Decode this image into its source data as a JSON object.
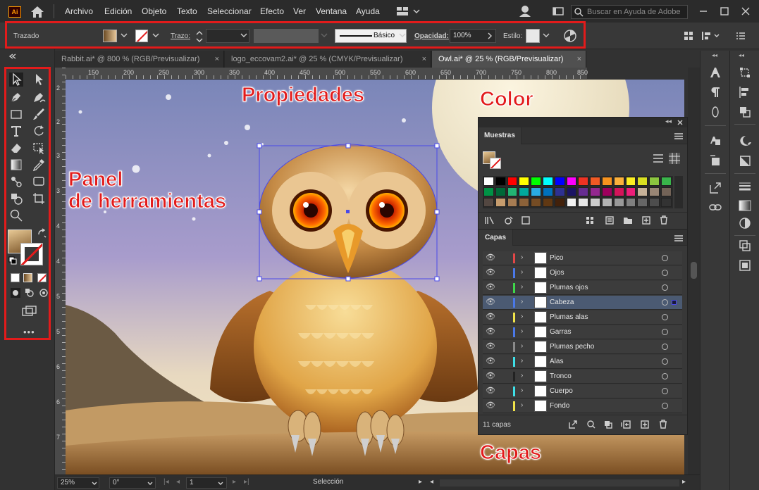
{
  "app": {
    "logo_text": "Ai",
    "menus": [
      "Archivo",
      "Edición",
      "Objeto",
      "Texto",
      "Seleccionar",
      "Efecto",
      "Ver",
      "Ventana",
      "Ayuda"
    ],
    "help_placeholder": "Buscar en Ayuda de Adobe"
  },
  "control_bar": {
    "mode_label": "Trazado",
    "stroke_label": "Trazo:",
    "brush_label": "Básico",
    "opacity_label": "Opacidad:",
    "opacity_value": "100%",
    "style_label": "Estilo:"
  },
  "tabs": [
    {
      "label": "Rabbit.ai* @ 800 % (RGB/Previsualizar)",
      "active": false
    },
    {
      "label": "logo_eccovam2.ai* @ 25 % (CMYK/Previsualizar)",
      "active": false
    },
    {
      "label": "Owl.ai* @ 25 % (RGB/Previsualizar)",
      "active": true
    }
  ],
  "tab_close_glyph": "×",
  "ruler": {
    "h": [
      "150",
      "200",
      "250",
      "300",
      "350",
      "400",
      "450",
      "500",
      "550",
      "600",
      "650",
      "700",
      "750",
      "800",
      "850"
    ],
    "v": [
      "2",
      "2",
      "3",
      "3",
      "4",
      "4",
      "5",
      "5",
      "6",
      "6",
      "7"
    ]
  },
  "annotations": {
    "properties": "Propiedades",
    "color": "Color",
    "tools_line1": "Panel",
    "tools_line2": "de herramientas",
    "layers": "Capas"
  },
  "swatches_panel": {
    "title": "Muestras",
    "colors": [
      "#ffffff",
      "#000000",
      "#ff0000",
      "#ffff00",
      "#00ff00",
      "#00ffff",
      "#0000ff",
      "#ff00ff",
      "#ee3223",
      "#f15a24",
      "#f7931e",
      "#fbb03b",
      "#fcee21",
      "#d9e021",
      "#8cc63f",
      "#39b54a",
      "#009245",
      "#006837",
      "#22b573",
      "#00a99d",
      "#29abe2",
      "#0071bc",
      "#2e3192",
      "#1b1464",
      "#662d91",
      "#93278f",
      "#9e005d",
      "#d4145a",
      "#ed1e79",
      "#c7b299",
      "#998675",
      "#736357",
      "#534741",
      "#c69c6d",
      "#a67c52",
      "#8c6239",
      "#754c24",
      "#603813",
      "#42210b",
      "#f2f2f2",
      "#e6e6e6",
      "#cccccc",
      "#b3b3b3",
      "#999999",
      "#808080",
      "#666666",
      "#4d4d4d",
      "#333333"
    ]
  },
  "layers_panel": {
    "title": "Capas",
    "count_text": "11 capas",
    "items": [
      {
        "name": "Pico",
        "color": "#e24747",
        "selected": false
      },
      {
        "name": "Ojos",
        "color": "#4a78e8",
        "selected": false
      },
      {
        "name": "Plumas ojos",
        "color": "#3ed64a",
        "selected": false
      },
      {
        "name": "Cabeza",
        "color": "#4a78e8",
        "selected": true
      },
      {
        "name": "Plumas alas",
        "color": "#f0e34a",
        "selected": false
      },
      {
        "name": "Garras",
        "color": "#4a78e8",
        "selected": false
      },
      {
        "name": "Plumas pecho",
        "color": "#8a8a8a",
        "selected": false
      },
      {
        "name": "Alas",
        "color": "#3ee0e8",
        "selected": false
      },
      {
        "name": "Tronco",
        "color": "#222222",
        "selected": false
      },
      {
        "name": "Cuerpo",
        "color": "#3ee0e8",
        "selected": false
      },
      {
        "name": "Fondo",
        "color": "#f0e34a",
        "selected": false
      }
    ]
  },
  "status_bar": {
    "zoom": "25%",
    "rotation": "0°",
    "artboard": "1",
    "tool_name": "Selección"
  },
  "colors": {
    "annotation_red": "#e21b1b",
    "selection_blue": "#4a4ae8"
  }
}
